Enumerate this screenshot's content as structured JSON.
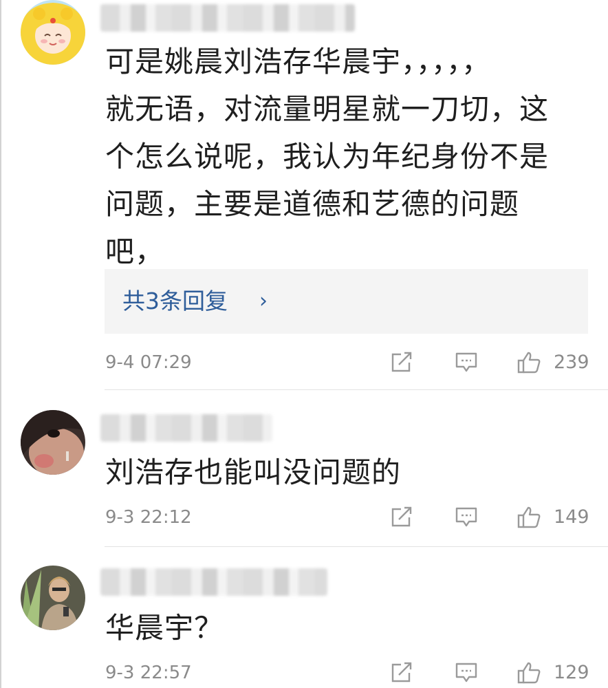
{
  "comments": [
    {
      "username": "",
      "text": "可是姚晨刘浩存华晨宇，，，，，\n就无语，对流量明星就一刀切，这\n个怎么说呢，我认为年纪身份不是\n问题，主要是道德和艺德的问题\n吧，",
      "replies_label": "共3条回复",
      "replies_chevron": "›",
      "time": "9-4 07:29",
      "likes": "239"
    },
    {
      "username": "",
      "text": "刘浩存也能叫没问题的",
      "time": "9-3 22:12",
      "likes": "149"
    },
    {
      "username": "",
      "text": "华晨宇？",
      "time": "9-3 22:57",
      "likes": "129"
    }
  ],
  "icons": {
    "share": "share-icon",
    "comment": "comment-icon",
    "like": "thumbs-up-icon"
  },
  "colors": {
    "link": "#2e5d9a",
    "meta": "#8a8a8a",
    "reply_bg": "#f4f4f4"
  }
}
